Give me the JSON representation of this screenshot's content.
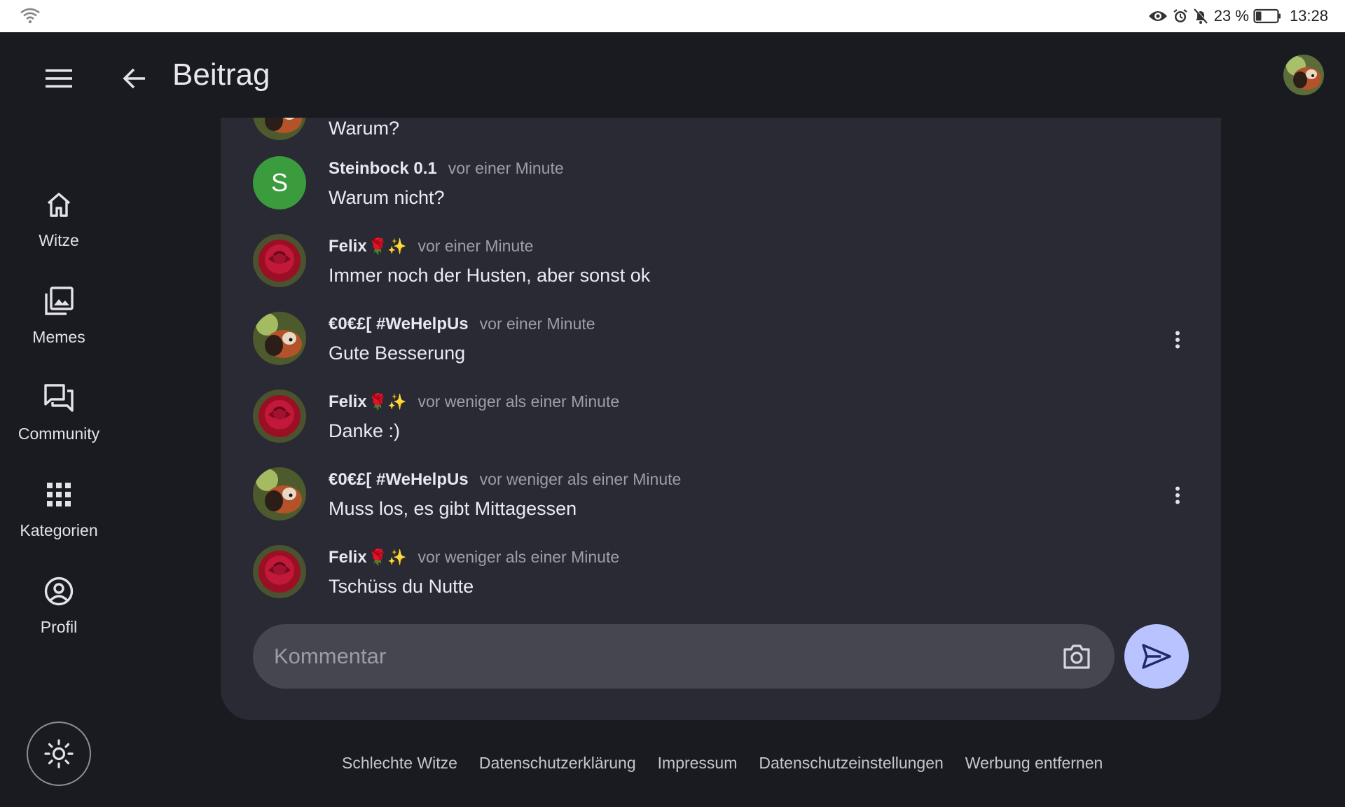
{
  "status_bar": {
    "battery_percent": "23 %",
    "time": "13:28"
  },
  "app_bar": {
    "title": "Beitrag"
  },
  "nav": {
    "items": [
      {
        "label": "Witze",
        "icon": "home-icon"
      },
      {
        "label": "Memes",
        "icon": "images-icon"
      },
      {
        "label": "Community",
        "icon": "forum-icon"
      },
      {
        "label": "Kategorien",
        "icon": "grid-icon"
      },
      {
        "label": "Profil",
        "icon": "account-circle-icon"
      }
    ]
  },
  "comments": {
    "partial": {
      "text": "Warum?"
    },
    "items": [
      {
        "author": "Steinbock 0.1",
        "emoji": "",
        "time": "vor einer Minute",
        "text": "Warum nicht?",
        "avatar": "S"
      },
      {
        "author": "Felix",
        "emoji": "🌹✨",
        "time": "vor einer Minute",
        "text": "Immer noch der Husten, aber sonst ok"
      },
      {
        "author": "€0€£[ #WeHelpUs",
        "emoji": "",
        "time": "vor einer Minute",
        "text": "Gute Besserung"
      },
      {
        "author": "Felix",
        "emoji": "🌹✨",
        "time": "vor weniger als einer Minute",
        "text": "Danke :)"
      },
      {
        "author": "€0€£[ #WeHelpUs",
        "emoji": "",
        "time": "vor weniger als einer Minute",
        "text": "Muss los, es gibt Mittagessen"
      },
      {
        "author": "Felix",
        "emoji": "🌹✨",
        "time": "vor weniger als einer Minute",
        "text": "Tschüss du Nutte"
      }
    ]
  },
  "compose": {
    "placeholder": "Kommentar",
    "value": ""
  },
  "footer": {
    "links": [
      "Schlechte Witze",
      "Datenschutzerklärung",
      "Impressum",
      "Datenschutzeinstellungen",
      "Werbung entfernen"
    ]
  },
  "colors": {
    "background": "#1a1b21",
    "card": "#292a33",
    "input": "#454650",
    "send_button": "#b8c3ff",
    "letter_avatar": "#3a9c3c"
  }
}
